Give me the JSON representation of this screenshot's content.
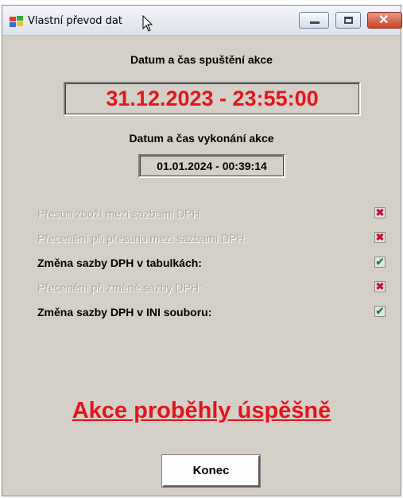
{
  "window": {
    "title": "Vlastní převod dat",
    "controls": {
      "minimize": "minimize",
      "maximize": "maximize",
      "close": "✕"
    }
  },
  "start": {
    "label": "Datum a čas spuštění akce",
    "value": "31.12.2023 - 23:55:00"
  },
  "execution": {
    "label": "Datum a čas vykonání akce",
    "value": "01.01.2024 - 00:39:14"
  },
  "actions": [
    {
      "label": "Přesun zboží mezi sazbami DPH:",
      "enabled": false,
      "state": "x",
      "symbol": "✖"
    },
    {
      "label": "Přecenění při přesunu mezi sazbami DPH:",
      "enabled": false,
      "state": "x",
      "symbol": "✖"
    },
    {
      "label": "Změna sazby DPH v tabulkách:",
      "enabled": true,
      "state": "check",
      "symbol": "✔"
    },
    {
      "label": "Přecenění při změně sazby DPH:",
      "enabled": false,
      "state": "x",
      "symbol": "✖"
    },
    {
      "label": "Změna sazby DPH v INI souboru:",
      "enabled": true,
      "state": "check",
      "symbol": "✔"
    }
  ],
  "result": {
    "text": "Akce proběhly úspěšně",
    "color": "#e4141b"
  },
  "buttons": {
    "close_label": "Konec"
  },
  "colors": {
    "accent_red": "#e4141b",
    "check_green": "#1a8a1a",
    "dialog_bg": "#d4d0c8"
  }
}
